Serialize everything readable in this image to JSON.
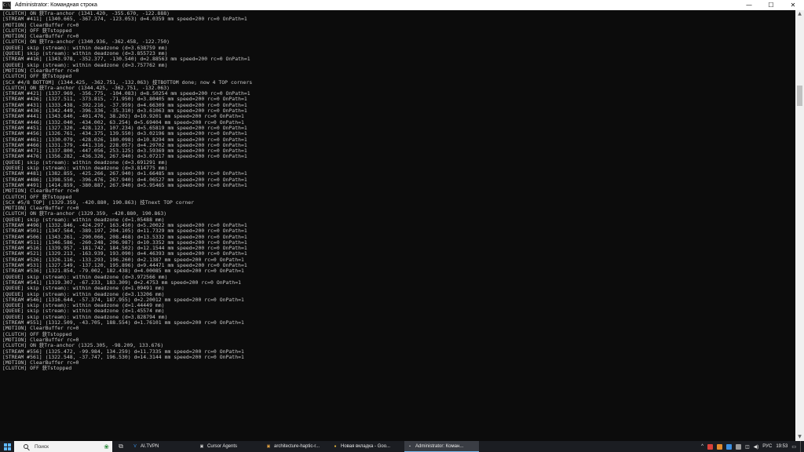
{
  "window": {
    "title": "Administrator: Командная строка",
    "app_icon_label": "C:\\",
    "controls": {
      "minimize": "—",
      "maximize": "☐",
      "close": "✕"
    }
  },
  "console_lines": [
    "[CLUTCH] ON 获Tra-anchor (1341.420, -355.670, -122.888)",
    "[STREAM #411] (1340.665, -367.374, -123.053) d=4.0359 mm speed=200 rc=0 OnPath=1",
    "[MOTION] ClearBuffer rc=0",
    "[CLUTCH] OFF 获Tstopped",
    "[MOTION] ClearBuffer rc=0",
    "[CLUTCH] ON 获Tra-anchor (1340.936, -362.458, -122.750)",
    "[QUEUE] skip (stream): within deadzone (d=3.638759 mm)",
    "[QUEUE] skip (stream): within deadzone (d=3.855723 mm)",
    "[STREAM #416] (1343.978, -352.377, -130.540) d=2.88563 mm speed=200 rc=0 OnPath=1",
    "[QUEUE] skip (stream): within deadzone (d=3.757762 mm)",
    "[MOTION] ClearBuffer rc=0",
    "[CLUTCH] OFF 获Tstopped",
    "[SCX #4/8 BOTTOM] (1344.425, -362.751, -132.063) 技TBOTTOM done; now 4 TOP corners",
    "[CLUTCH] ON 获Tra-anchor (1344.425, -362.751, -132.063)",
    "[STREAM #421] (1337.969, -356.775, -104.083) d=8.50254 mm speed=200 rc=0 OnPath=1",
    "[STREAM #426] (1327.511, -373.815, -71.950) d=3.80405 mm speed=200 rc=0 OnPath=1",
    "[STREAM #431] (1333.438, -392.216, -37.959) d=4.66309 mm speed=200 rc=0 OnPath=1",
    "[STREAM #436] (1342.449, -396.336, -35.310) d=3.61063 mm speed=200 rc=0 OnPath=1",
    "[STREAM #441] (1343.640, -401.476, 38.202) d=10.9201 mm speed=200 rc=0 OnPath=1",
    "[STREAM #446] (1332.040, -434.002, 63.254) d=5.69404 mm speed=200 rc=0 OnPath=1",
    "[STREAM #451] (1327.320, -428.123, 107.234) d=5.65819 mm speed=200 rc=0 OnPath=1",
    "[STREAM #456] (1326.761, -434.375, 139.550) d=3.02196 mm speed=200 rc=0 OnPath=1",
    "[STREAM #461] (1330.079, -428.026, 180.098) d=10.8294 mm speed=200 rc=0 OnPath=1",
    "[STREAM #466] (1331.379, -441.316, 228.057) d=4.29702 mm speed=200 rc=0 OnPath=1",
    "[STREAM #471] (1337.800, -447.056, 253.125) d=3.59369 mm speed=200 rc=0 OnPath=1",
    "[STREAM #476] (1356.282, -436.326, 267.940) d=3.07217 mm speed=200 rc=0 OnPath=1",
    "[QUEUE] skip (stream): within deadzone (d=3.691291 mm)",
    "[QUEUE] skip (stream): within deadzone (d=3.814775 mm)",
    "[STREAM #481] (1382.855, -425.266, 267.940) d=1.66485 mm speed=200 rc=0 OnPath=1",
    "[STREAM #486] (1398.550, -396.476, 267.940) d=4.06527 mm speed=200 rc=0 OnPath=1",
    "[STREAM #491] (1414.859, -380.887, 267.940) d=5.95465 mm speed=200 rc=0 OnPath=1",
    "[MOTION] ClearBuffer rc=0",
    "[CLUTCH] OFF 获Tstopped",
    "[SCX #5/8 TOP] (1329.359, -420.880, 190.863) 技Tnext TOP corner",
    "[MOTION] ClearBuffer rc=0",
    "[CLUTCH] ON 获Tra-anchor (1329.359, -420.880, 190.863)",
    "[QUEUE] skip (stream): within deadzone (d=1.05488 mm)",
    "[STREAM #496] (1332.846, -424.297, 163.450) d=5.20022 mm speed=200 rc=0 OnPath=1",
    "[STREAM #501] (1347.564, -389.197, 204.105) d=11.7329 mm speed=200 rc=0 OnPath=1",
    "[STREAM #506] (1343.261, -290.066, 208.468) d=13.5332 mm speed=200 rc=0 OnPath=1",
    "[STREAM #511] (1346.586, -260.248, 206.987) d=10.3352 mm speed=200 rc=0 OnPath=1",
    "[STREAM #516] (1339.957, -181.742, 184.502) d=12.1544 mm speed=200 rc=0 OnPath=1",
    "[STREAM #521] (1329.213, -163.939, 193.090) d=4.46393 mm speed=200 rc=0 OnPath=1",
    "[STREAM #526] (1326.116, -133.293, 196.260) d=2.1387 mm speed=200 rc=0 OnPath=1",
    "[STREAM #531] (1327.549, -137.120, 195.896) d=9.44471 mm speed=200 rc=0 OnPath=1",
    "[STREAM #536] (1321.854, -79.002, 182.438) d=4.00085 mm speed=200 rc=0 OnPath=1",
    "[QUEUE] skip (stream): within deadzone (d=3.972566 mm)",
    "[STREAM #541] (1319.307, -67.233, 183.309) d=2.4753 mm speed=200 rc=0 OnPath=1",
    "[QUEUE] skip (stream): within deadzone (d=1.09491 mm)",
    "[QUEUE] skip (stream): within deadzone (d=3.13206 mm)",
    "[STREAM #546] (1316.644, -57.374, 187.955) d=2.20012 mm speed=200 rc=0 OnPath=1",
    "[QUEUE] skip (stream): within deadzone (d=1.44449 mm)",
    "[QUEUE] skip (stream): within deadzone (d=1.45574 mm)",
    "[QUEUE] skip (stream): within deadzone (d=3.828794 mm)",
    "[STREAM #551] (1312.509, -43.705, 188.554) d=1.76101 mm speed=200 rc=0 OnPath=1",
    "[MOTION] ClearBuffer rc=0",
    "[CLUTCH] OFF 获Tstopped",
    "[MOTION] ClearBuffer rc=0",
    "[CLUTCH] ON 获Tra-anchor (1325.305, -98.209, 133.676)",
    "[STREAM #556] (1325.472, -99.984, 134.259) d=11.7335 mm speed=200 rc=0 OnPath=1",
    "[STREAM #561] (1322.548, -37.747, 196.530) d=14.3144 mm speed=200 rc=0 OnPath=1",
    "[MOTION] ClearBuffer rc=0",
    "[CLUTCH] OFF 获Tstopped"
  ],
  "scrollbar": {
    "up": "▲",
    "down": "▼"
  },
  "taskbar": {
    "search_placeholder": "Поиск",
    "tasks": [
      {
        "label": "AI.TVPN",
        "icon": "V",
        "icon_color": "#3aa0ff"
      },
      {
        "label": "Cursor Agents",
        "icon": "▣",
        "icon_color": "#cfcfcf"
      },
      {
        "label": "architecture-haptic-r...",
        "icon": "▣",
        "icon_color": "#e0a040"
      },
      {
        "label": "Новая вкладка - Goo...",
        "icon": "●",
        "icon_color": "#e9b93a"
      },
      {
        "label": "Administrator: Коман...",
        "icon": "▪",
        "icon_color": "#cfcfcf"
      }
    ],
    "tray": {
      "language": "РУС",
      "time": "19:53",
      "expand": "^"
    },
    "colors": {
      "accent": "#76b9ed",
      "background": "#1b1d22",
      "console_text": "#c8c8c8"
    }
  }
}
